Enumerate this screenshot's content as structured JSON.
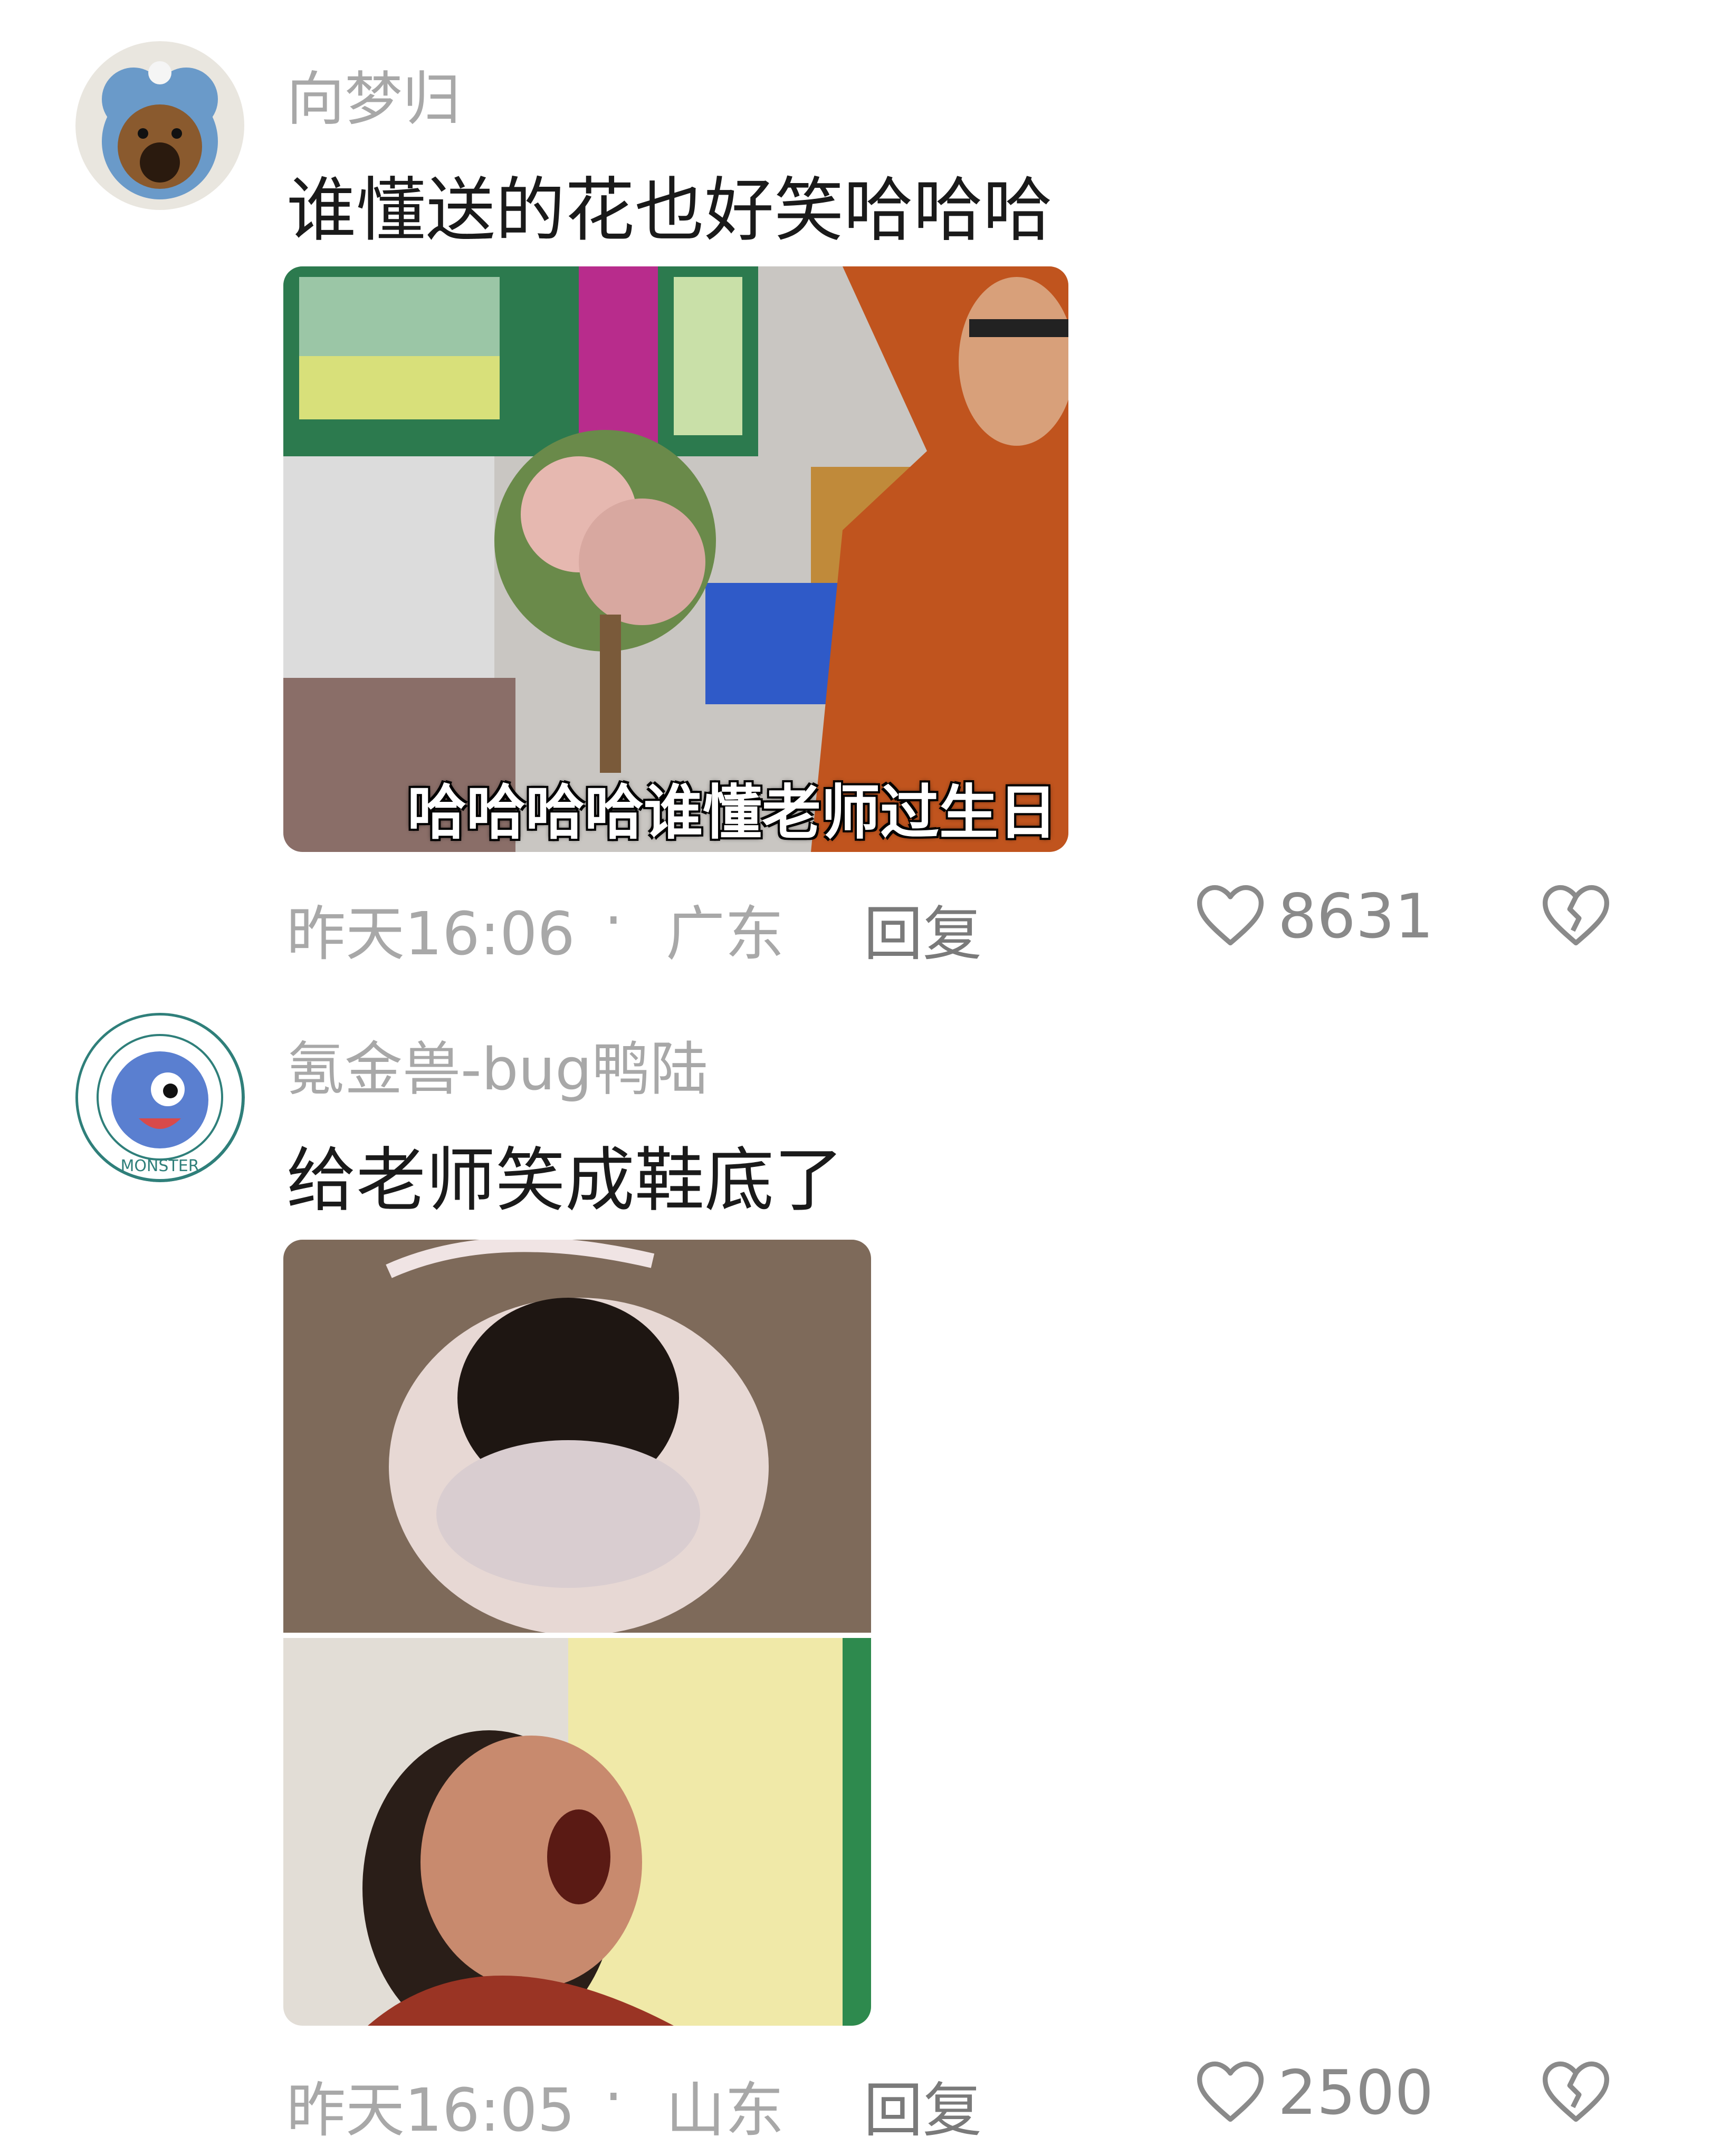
{
  "comments": [
    {
      "username": "向梦归",
      "text": "谁懂送的花也好笑哈哈哈",
      "image_caption": "哈哈哈哈谁懂老师过生日",
      "time": "昨天16:06",
      "separator": "·",
      "location": "广东",
      "reply_label": "回复",
      "like_count": "8631"
    },
    {
      "username": "氪金兽-bug鸭陆",
      "text": "给老师笑成鞋底了",
      "avatar_text": "MONSTER",
      "time": "昨天16:05",
      "separator": "·",
      "location": "山东",
      "reply_label": "回复",
      "like_count": "2500"
    }
  ],
  "icons": {
    "like": "heart-outline-icon",
    "dislike": "broken-heart-icon"
  },
  "colors": {
    "username": "#a8a8a8",
    "text": "#1a1a1a",
    "meta": "#a8a8a8",
    "background": "#ffffff"
  }
}
